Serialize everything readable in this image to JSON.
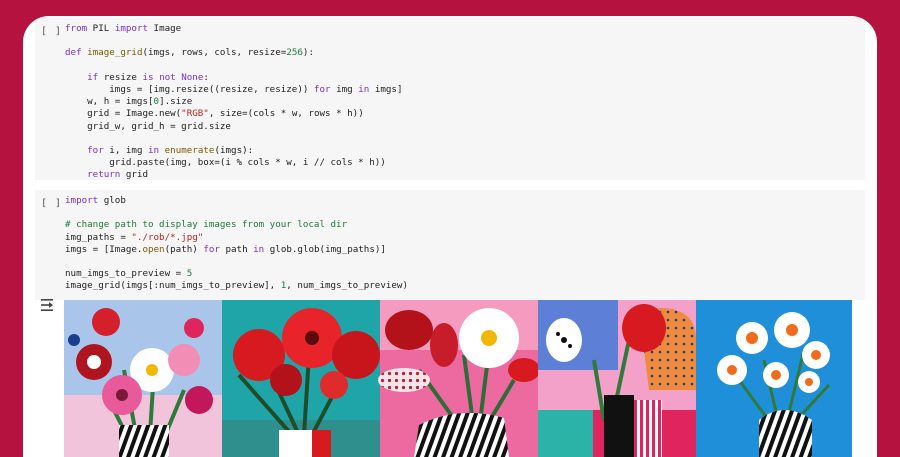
{
  "cell1": {
    "run_label": "[ ]",
    "lines": [
      [
        [
          "kw",
          "from"
        ],
        [
          "t",
          " PIL "
        ],
        [
          "kw",
          "import"
        ],
        [
          "t",
          " Image"
        ]
      ],
      [],
      [
        [
          "kw",
          "def"
        ],
        [
          "t",
          " "
        ],
        [
          "fn",
          "image_grid"
        ],
        [
          "t",
          "(imgs, rows, cols, resize="
        ],
        [
          "num",
          "256"
        ],
        [
          "t",
          "):"
        ]
      ],
      [],
      [
        [
          "t",
          "    "
        ],
        [
          "kw",
          "if"
        ],
        [
          "t",
          " resize "
        ],
        [
          "kw",
          "is not"
        ],
        [
          "t",
          " "
        ],
        [
          "kw",
          "None"
        ],
        [
          "t",
          ":"
        ]
      ],
      [
        [
          "t",
          "        imgs = [img.resize((resize, resize)) "
        ],
        [
          "kw",
          "for"
        ],
        [
          "t",
          " img "
        ],
        [
          "kw",
          "in"
        ],
        [
          "t",
          " imgs]"
        ]
      ],
      [
        [
          "t",
          "    w, h = imgs["
        ],
        [
          "num",
          "0"
        ],
        [
          "t",
          "].size"
        ]
      ],
      [
        [
          "t",
          "    grid = Image.new("
        ],
        [
          "str",
          "\"RGB\""
        ],
        [
          "t",
          ", size=(cols * w, rows * h))"
        ]
      ],
      [
        [
          "t",
          "    grid_w, grid_h = grid.size"
        ]
      ],
      [],
      [
        [
          "t",
          "    "
        ],
        [
          "kw",
          "for"
        ],
        [
          "t",
          " i, img "
        ],
        [
          "kw",
          "in"
        ],
        [
          "t",
          " "
        ],
        [
          "fn",
          "enumerate"
        ],
        [
          "t",
          "(imgs):"
        ]
      ],
      [
        [
          "t",
          "        grid.paste(img, box=(i % cols * w, i // cols * h))"
        ]
      ],
      [
        [
          "t",
          "    "
        ],
        [
          "kw",
          "return"
        ],
        [
          "t",
          " grid"
        ]
      ]
    ]
  },
  "cell2": {
    "run_label": "[ ]",
    "lines": [
      [
        [
          "kw",
          "import"
        ],
        [
          "t",
          " glob"
        ]
      ],
      [],
      [
        [
          "cm",
          "# change path to display images from your local dir"
        ]
      ],
      [
        [
          "t",
          "img_paths = "
        ],
        [
          "str",
          "\"./rob/*.jpg\""
        ]
      ],
      [
        [
          "t",
          "imgs = [Image."
        ],
        [
          "fn",
          "open"
        ],
        [
          "t",
          "(path) "
        ],
        [
          "kw",
          "for"
        ],
        [
          "t",
          " path "
        ],
        [
          "kw",
          "in"
        ],
        [
          "t",
          " glob.glob(img_paths)]"
        ]
      ],
      [],
      [
        [
          "t",
          "num_imgs_to_preview = "
        ],
        [
          "num",
          "5"
        ]
      ],
      [
        [
          "t",
          "image_grid(imgs[:num_imgs_to_preview], "
        ],
        [
          "num",
          "1"
        ],
        [
          "t",
          ", num_imgs_to_preview)"
        ]
      ]
    ]
  },
  "output": {
    "icon": "output-arrow-icon",
    "images": [
      "painting-flowers-pink-red",
      "painting-red-poppies-teal",
      "painting-daisy-pink-vase",
      "painting-tulip-striped-vase",
      "painting-white-blooms-blue"
    ]
  },
  "colors": {
    "frame": "#b5123f",
    "cell_bg": "#f6f6f6",
    "keyword": "#7b30d0",
    "string": "#b3261e",
    "number": "#1a7f37"
  }
}
